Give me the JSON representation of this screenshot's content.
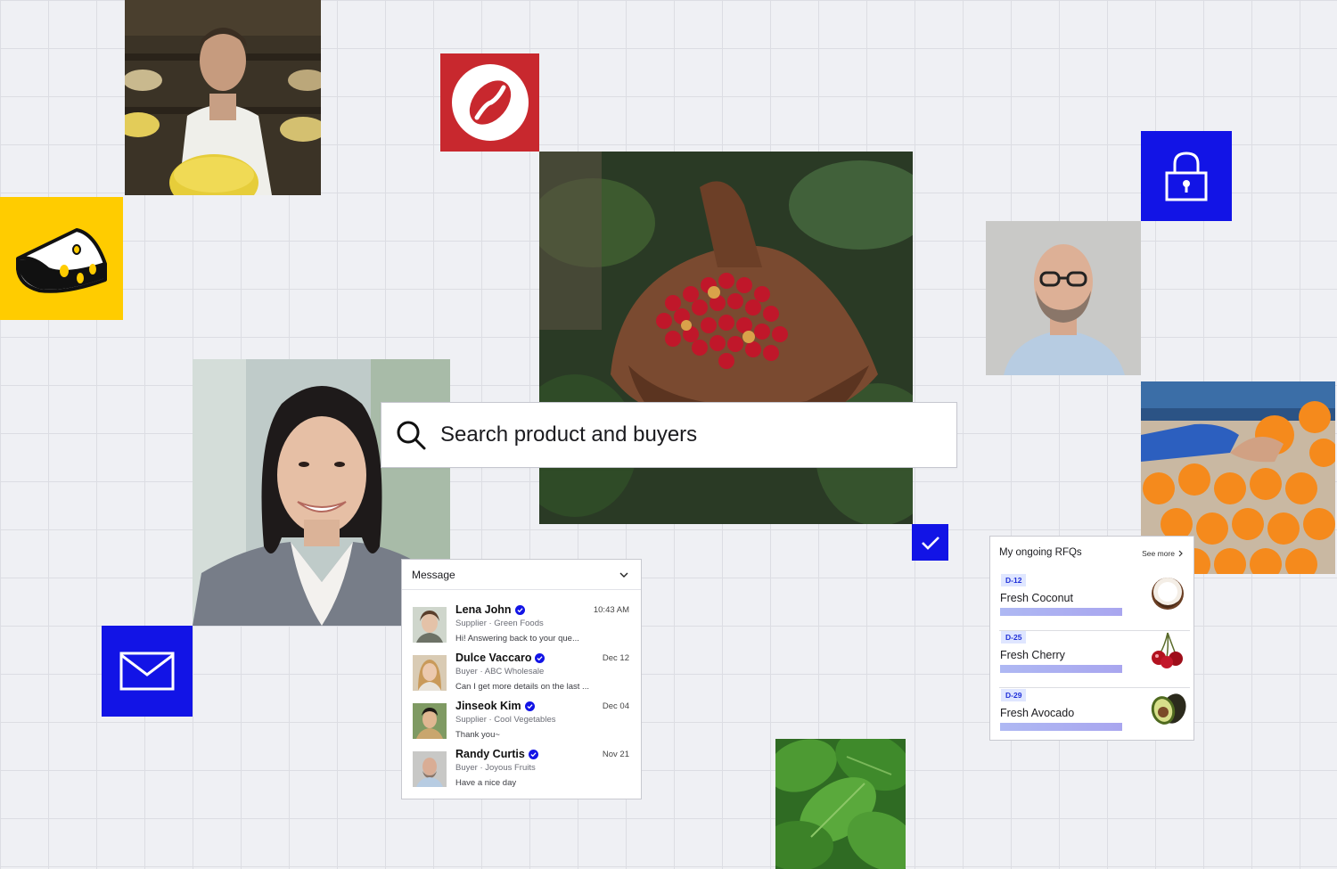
{
  "search": {
    "placeholder": "Search product and buyers"
  },
  "icons": {
    "coffee": "coffee-bean-icon",
    "cheese": "cheese-icon",
    "lock": "lock-icon",
    "mail": "mail-icon",
    "check": "check-icon",
    "search": "search-icon"
  },
  "colors": {
    "coffee_tile": "#c8282e",
    "cheese_tile": "#ffcc00",
    "brand_blue": "#1214e6",
    "grid_background": "#eff0f4"
  },
  "messages": {
    "title": "Message",
    "items": [
      {
        "name": "Lena John",
        "role": "Supplier · Green Foods",
        "time": "10:43 AM",
        "preview": "Hi!  Answering back to your que..."
      },
      {
        "name": "Dulce Vaccaro",
        "role": "Buyer · ABC Wholesale",
        "time": "Dec 12",
        "preview": "Can I get more details on the last ..."
      },
      {
        "name": "Jinseok Kim",
        "role": "Supplier · Cool Vegetables",
        "time": "Dec 04",
        "preview": "Thank you~"
      },
      {
        "name": "Randy Curtis",
        "role": "Buyer · Joyous Fruits",
        "time": "Nov 21",
        "preview": "Have a nice day"
      }
    ]
  },
  "rfqs": {
    "title": "My ongoing RFQs",
    "see_more": "See more",
    "items": [
      {
        "badge": "D-12",
        "product": "Fresh Coconut",
        "progress": 1.0
      },
      {
        "badge": "D-25",
        "product": "Fresh Cherry",
        "progress": 1.0
      },
      {
        "badge": "D-29",
        "product": "Fresh Avocado",
        "progress": 1.0
      }
    ]
  }
}
